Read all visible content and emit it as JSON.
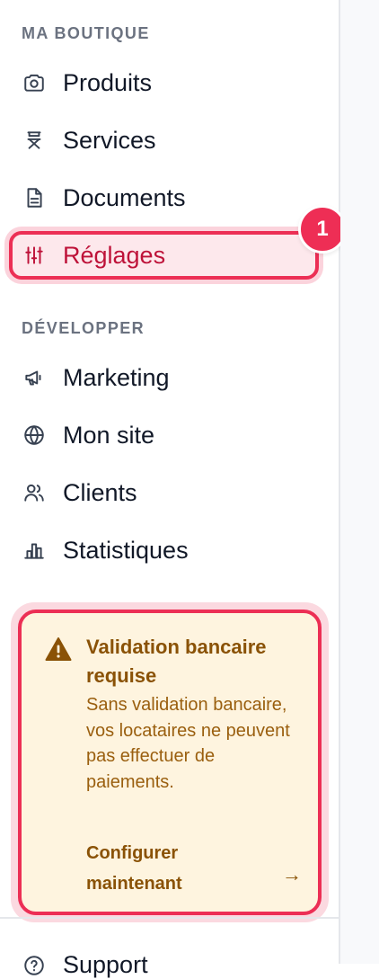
{
  "sidebar": {
    "sections": [
      {
        "title": "MA BOUTIQUE",
        "items": [
          {
            "label": "Produits",
            "icon": "camera-icon"
          },
          {
            "label": "Services",
            "icon": "service-icon"
          },
          {
            "label": "Documents",
            "icon": "document-icon"
          },
          {
            "label": "Réglages",
            "icon": "sliders-icon",
            "active": true
          }
        ]
      },
      {
        "title": "DÉVELOPPER",
        "items": [
          {
            "label": "Marketing",
            "icon": "megaphone-icon"
          },
          {
            "label": "Mon site",
            "icon": "globe-icon"
          },
          {
            "label": "Clients",
            "icon": "users-icon"
          },
          {
            "label": "Statistiques",
            "icon": "bar-chart-icon"
          }
        ]
      }
    ],
    "step_badge": "1",
    "alert": {
      "title": "Validation bancaire requise",
      "body": "Sans validation bancaire, vos locataires ne peuvent pas effectuer de paiements.",
      "link_label": "Configurer maintenant",
      "arrow": "→",
      "colors": {
        "background": "#fef4df",
        "border": "#ec2f55",
        "text": "#8a5206"
      }
    },
    "bottom_item": {
      "label": "Support",
      "icon": "help-circle-icon"
    }
  },
  "colors": {
    "accent": "#ec2f55",
    "active_text": "#be1239",
    "active_bg": "#fde8ec",
    "section_title": "#6b7280"
  }
}
